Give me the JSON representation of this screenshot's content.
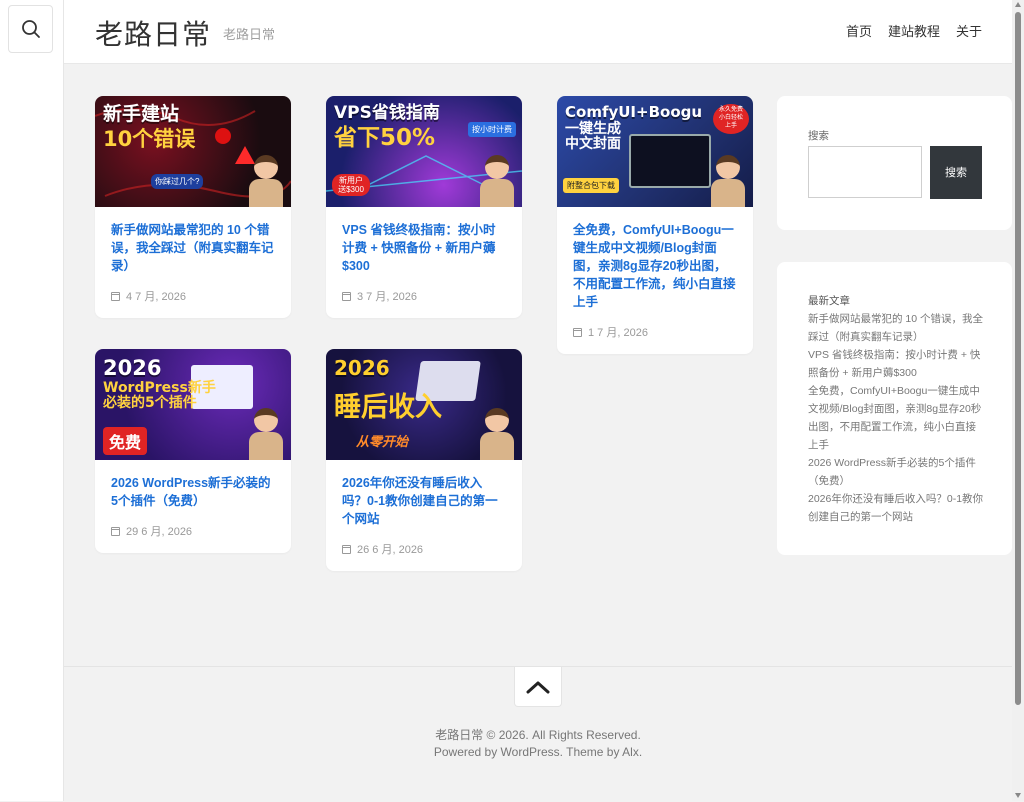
{
  "site": {
    "title": "老路日常",
    "description": "老路日常"
  },
  "sidebar_toggle": {
    "icon": "search-icon"
  },
  "nav": {
    "items": [
      {
        "label": "首页"
      },
      {
        "label": "建站教程"
      },
      {
        "label": "关于"
      }
    ]
  },
  "posts": [
    {
      "title": "新手做网站最常犯的 10 个错误，我全踩过（附真实翻车记录）",
      "date": "4 7 月, 2026",
      "thumb": {
        "line1": "新手建站",
        "line2": "10个错误",
        "badge": "你踩过几个?",
        "bg": "#1a0c10",
        "accent": "#ff3b3b"
      }
    },
    {
      "title": "VPS 省钱终极指南：按小时计费 + 快照备份 + 新用户薅$300",
      "date": "3 7 月, 2026",
      "thumb": {
        "line1": "VPS省钱指南",
        "line2": "省下50%",
        "badge": "按小时计费",
        "badge2": "新用户送$300",
        "bg": "#1b1f6b",
        "accent": "#ffd23f"
      }
    },
    {
      "title": "全免费，ComfyUI+Boogu一键生成中文视频/Blog封面图，亲测8g显存20秒出图，不用配置工作流，纯小白直接上手",
      "date": "1 7 月, 2026",
      "thumb": {
        "line1": "ComfyUI+Boogu",
        "line2": "一键生成 中文封面",
        "badge": "永久免费 小白轻松上手",
        "badge2": "附整合包下载",
        "bg": "#20306e",
        "accent": "#ffd23f"
      }
    },
    {
      "title": "2026 WordPress新手必装的5个插件（免费）",
      "date": "29 6 月, 2026",
      "thumb": {
        "line1": "2026",
        "line2": "WordPress新手 必装的5个插件",
        "badge": "免费",
        "bg": "#2a1466",
        "accent": "#ffd23f"
      }
    },
    {
      "title": "2026年你还没有睡后收入吗？0-1教你创建自己的第一个网站",
      "date": "26 6 月, 2026",
      "thumb": {
        "line1": "2026",
        "line2": "睡后收入",
        "badge": "从零开始",
        "bg": "#16123e",
        "accent": "#ffcf2e"
      }
    }
  ],
  "search_widget": {
    "label": "搜索",
    "input_value": "",
    "button_label": "搜索"
  },
  "recent_widget": {
    "title": "最新文章",
    "items": [
      "新手做网站最常犯的 10 个错误，我全踩过（附真实翻车记录）",
      "VPS 省钱终极指南：按小时计费 + 快照备份 + 新用户薅$300",
      "全免费，ComfyUI+Boogu一键生成中文视频/Blog封面图，亲测8g显存20秒出图，不用配置工作流，纯小白直接上手",
      "2026 WordPress新手必装的5个插件（免费）",
      "2026年你还没有睡后收入吗？0-1教你创建自己的第一个网站"
    ]
  },
  "footer": {
    "to_top_icon": "chevron-up-icon",
    "copyright": "老路日常 © 2026. All Rights Reserved.",
    "powered": "Powered by WordPress. Theme by Alx."
  },
  "colors": {
    "link": "#1d6fd6",
    "button": "#32373c",
    "page_bg": "#f2f2f2"
  }
}
